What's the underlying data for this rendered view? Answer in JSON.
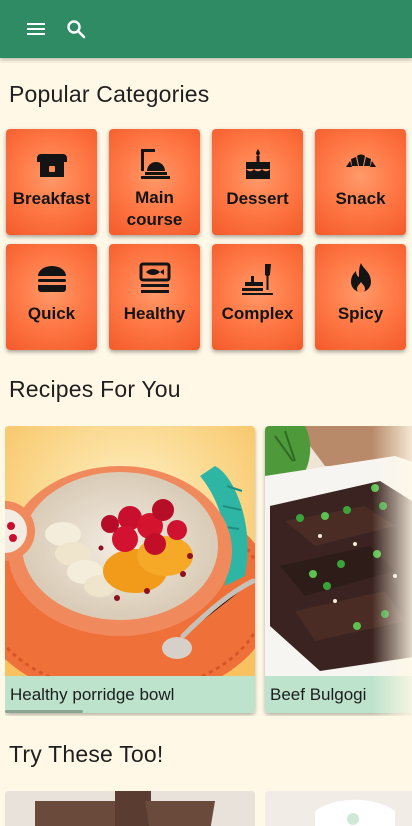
{
  "appbar": {
    "menu_icon": "hamburger-menu-icon",
    "search_icon": "search-icon",
    "color": "#2e8b63"
  },
  "sections": {
    "categories_title": "Popular Categories",
    "recipes_title": "Recipes For You",
    "try_title": "Try These Too!"
  },
  "categories": [
    {
      "label": "Breakfast",
      "icon": "bread-icon"
    },
    {
      "label": "Main course",
      "icon": "serving-cloche-icon"
    },
    {
      "label": "Dessert",
      "icon": "cake-icon"
    },
    {
      "label": "Snack",
      "icon": "croissant-icon"
    },
    {
      "label": "Quick",
      "icon": "burger-icon"
    },
    {
      "label": "Healthy",
      "icon": "set-meal-icon"
    },
    {
      "label": "Complex",
      "icon": "dinner-dining-icon"
    },
    {
      "label": "Spicy",
      "icon": "fire-icon"
    }
  ],
  "recipes": [
    {
      "title": "Healthy porridge bowl"
    },
    {
      "title": "Beef Bulgogi"
    }
  ],
  "colors": {
    "background": "#fff8e6",
    "category_tile": "#ff7a47",
    "caption_bar": "#bde3cc"
  }
}
